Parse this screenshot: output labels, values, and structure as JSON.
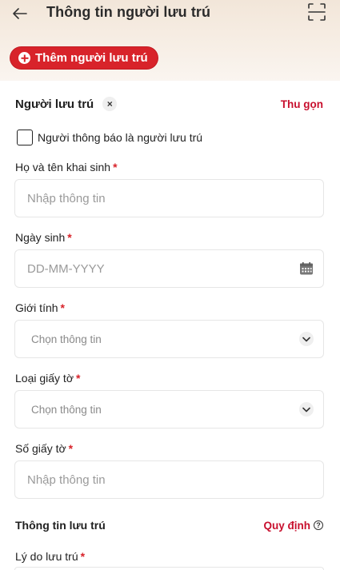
{
  "header": {
    "title": "Thông tin người lưu trú",
    "back_icon": "arrow-left-icon",
    "scan_icon": "qr-scan-icon"
  },
  "add_button": {
    "label": "Thêm người lưu trú",
    "icon": "plus-circle-icon"
  },
  "resident_section": {
    "title": "Người lưu trú",
    "close_icon": "×",
    "collapse_label": "Thu gọn"
  },
  "checkbox": {
    "label": "Người thông báo là người lưu trú",
    "checked": false
  },
  "fields": {
    "full_name": {
      "label": "Họ và tên khai sinh",
      "required": "*",
      "placeholder": "Nhập thông tin"
    },
    "dob": {
      "label": "Ngày sinh",
      "required": "*",
      "placeholder": "DD-MM-YYYY",
      "icon": "calendar-icon"
    },
    "gender": {
      "label": "Giới tính",
      "required": "*",
      "placeholder": "Chọn thông tin",
      "icon": "chevron-down-icon"
    },
    "doc_type": {
      "label": "Loại giấy tờ",
      "required": "*",
      "placeholder": "Chọn thông tin",
      "icon": "chevron-down-icon"
    },
    "doc_number": {
      "label": "Số giấy tờ",
      "required": "*",
      "placeholder": "Nhập thông tin"
    },
    "reason": {
      "label": "Lý do lưu trú",
      "required": "*"
    }
  },
  "stay_section": {
    "title": "Thông tin lưu trú",
    "rules_label": "Quy định",
    "help_icon": "?"
  },
  "colors": {
    "accent": "#d8232a",
    "link": "#c8102e"
  }
}
